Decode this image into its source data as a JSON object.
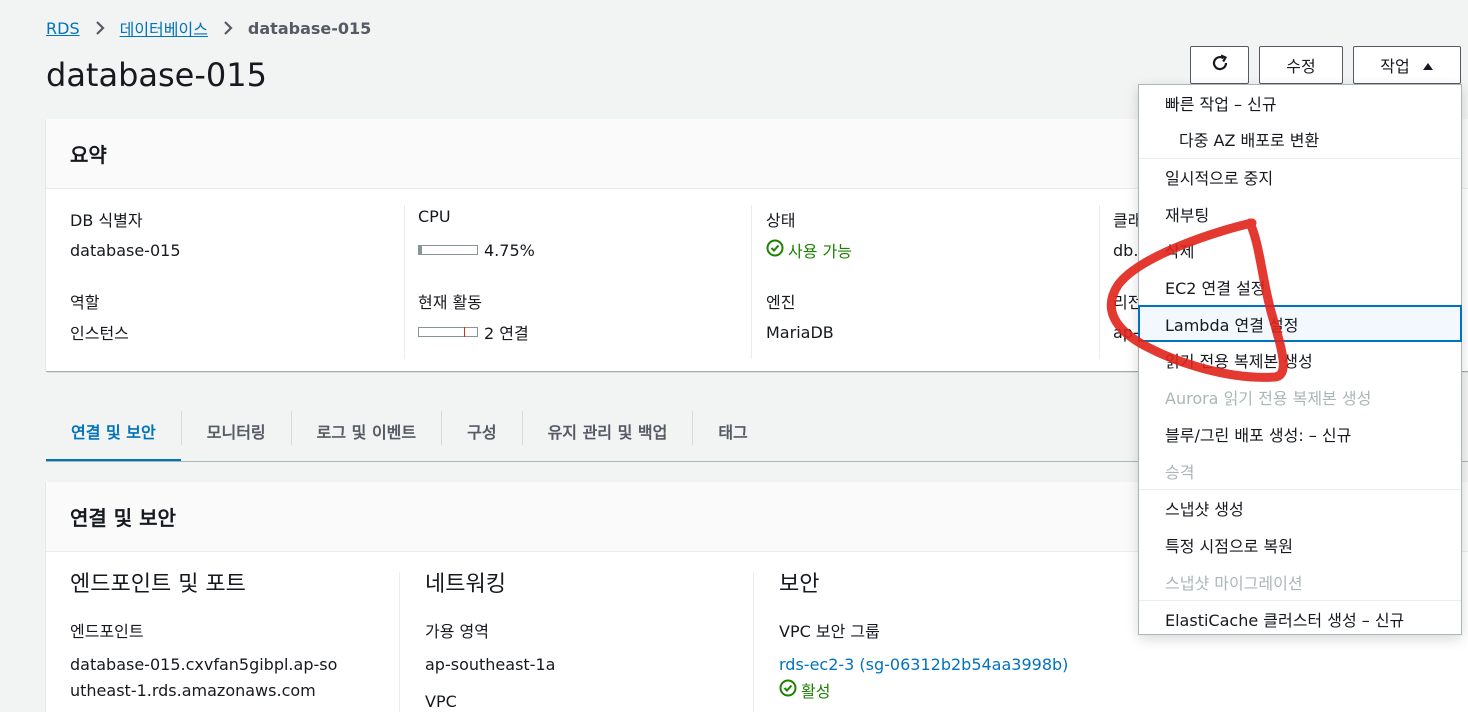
{
  "breadcrumb": {
    "root": "RDS",
    "parent": "데이터베이스",
    "current": "database-015"
  },
  "page_title": "database-015",
  "toolbar": {
    "edit_label": "수정",
    "actions_label": "작업"
  },
  "summary": {
    "header": "요약",
    "db_id_label": "DB 식별자",
    "db_id_value": "database-015",
    "cpu_label": "CPU",
    "cpu_value": "4.75%",
    "status_label": "상태",
    "status_value": "사용 가능",
    "class_label": "클래",
    "class_value": "db.",
    "role_label": "역할",
    "role_value": "인스턴스",
    "activity_label": "현재 활동",
    "activity_value": "2 연결",
    "engine_label": "엔진",
    "engine_value": "MariaDB",
    "region_label": "리전",
    "region_value": "ap-"
  },
  "tabs": [
    "연결 및 보안",
    "모니터링",
    "로그 및 이벤트",
    "구성",
    "유지 관리 및 백업",
    "태그"
  ],
  "connectivity": {
    "header": "연결 및 보안",
    "endpoint_head": "엔드포인트 및 포트",
    "endpoint_label": "엔드포인트",
    "endpoint_value": "database-015.cxvfan5gibpl.ap-southeast-1.rds.amazonaws.com",
    "network_head": "네트워킹",
    "az_label": "가용 영역",
    "az_value": "ap-southeast-1a",
    "vpc_label": "VPC",
    "security_head": "보안",
    "sg_label": "VPC 보안 그룹",
    "sg_value": "rds-ec2-3 (sg-06312b2b54aa3998b)",
    "sg_status": "활성"
  },
  "dropdown": {
    "quick_actions_label": "빠른 작업 – 신규",
    "items": {
      "multi_az": "다중 AZ 배포로 변환",
      "stop": "일시적으로 중지",
      "reboot": "재부팅",
      "delete": "삭제",
      "ec2_connect": "EC2 연결 설정",
      "lambda_connect": "Lambda 연결 설정",
      "read_replica": "읽기 전용 복제본 생성",
      "aurora_replica": "Aurora 읽기 전용 복제본 생성",
      "blue_green": "블루/그린 배포 생성: – 신규",
      "promote": "승격",
      "snapshot": "스냅샷 생성",
      "restore_pit": "특정 시점으로 복원",
      "snapshot_migrate": "스냅샷 마이그레이션",
      "elasticache": "ElastiCache 클러스터 생성 – 신규"
    }
  },
  "metrics": {
    "cpu_fraction": 0.0475,
    "connections": 2
  },
  "colors": {
    "link": "#0073bb",
    "success": "#1d8102",
    "disabled": "#aab7b8",
    "annotation": "#e0231b"
  }
}
